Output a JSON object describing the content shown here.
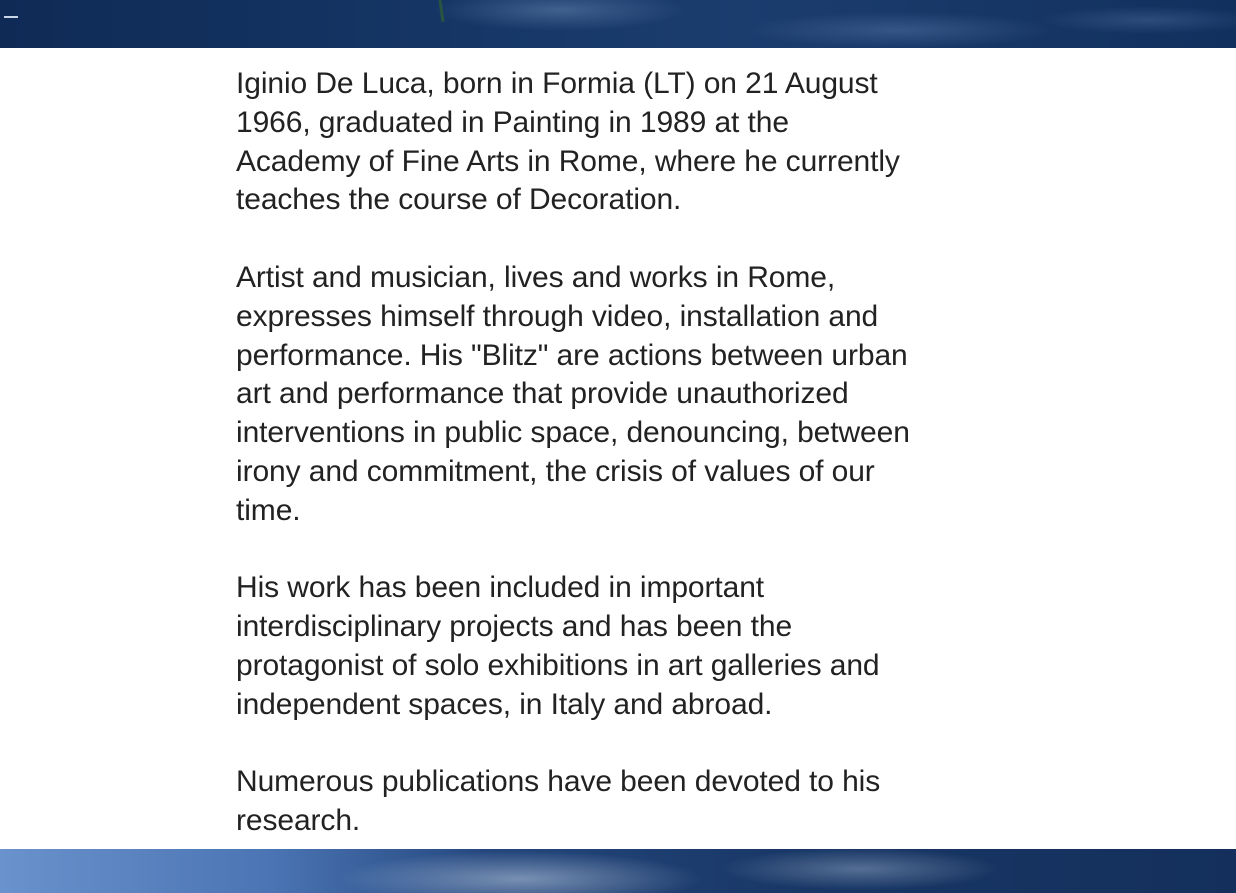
{
  "bio": {
    "paragraphs": [
      "Iginio De Luca, born in Formia (LT) on 21 August\n1966, graduated in Painting in 1989 at the\nAcademy of Fine Arts in Rome, where he currently\nteaches the course of Decoration.",
      "Artist and musician, lives and works in Rome,\nexpresses himself through video, installation and\nperformance. His \"Blitz\" are actions between urban\nart and performance that provide unauthorized\ninterventions in public space, denouncing, between\nirony and commitment, the crisis of values of our\ntime.",
      "His work has been included in important\ninterdisciplinary projects and has been the\nprotagonist of solo exhibitions in art galleries and\nindependent spaces, in Italy and abroad.",
      "Numerous publications have been devoted to his\nresearch."
    ]
  },
  "colors": {
    "text": "#222222",
    "band_dark": "#163767",
    "band_light": "#6a92cc"
  }
}
